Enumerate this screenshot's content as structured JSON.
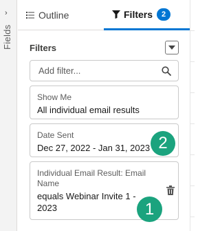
{
  "fields_panel": {
    "label": "Fields",
    "chevron": "›"
  },
  "tabs": [
    {
      "label": "Outline",
      "icon": "list-icon"
    },
    {
      "label": "Filters",
      "icon": "funnel-icon",
      "badge": "2"
    }
  ],
  "filters": {
    "title": "Filters",
    "search_placeholder": "Add filter...",
    "items": [
      {
        "label": "Show Me",
        "value": "All individual email results"
      },
      {
        "label": "Date Sent",
        "value": "Dec 27, 2022 - Jan 31, 2023"
      },
      {
        "label": "Individual Email Result: Email Name",
        "value": "equals Webinar Invite 1 - 2023"
      }
    ]
  },
  "markers": [
    "1",
    "2"
  ],
  "colors": {
    "accent": "#0176d3",
    "marker": "#1ba37e"
  }
}
